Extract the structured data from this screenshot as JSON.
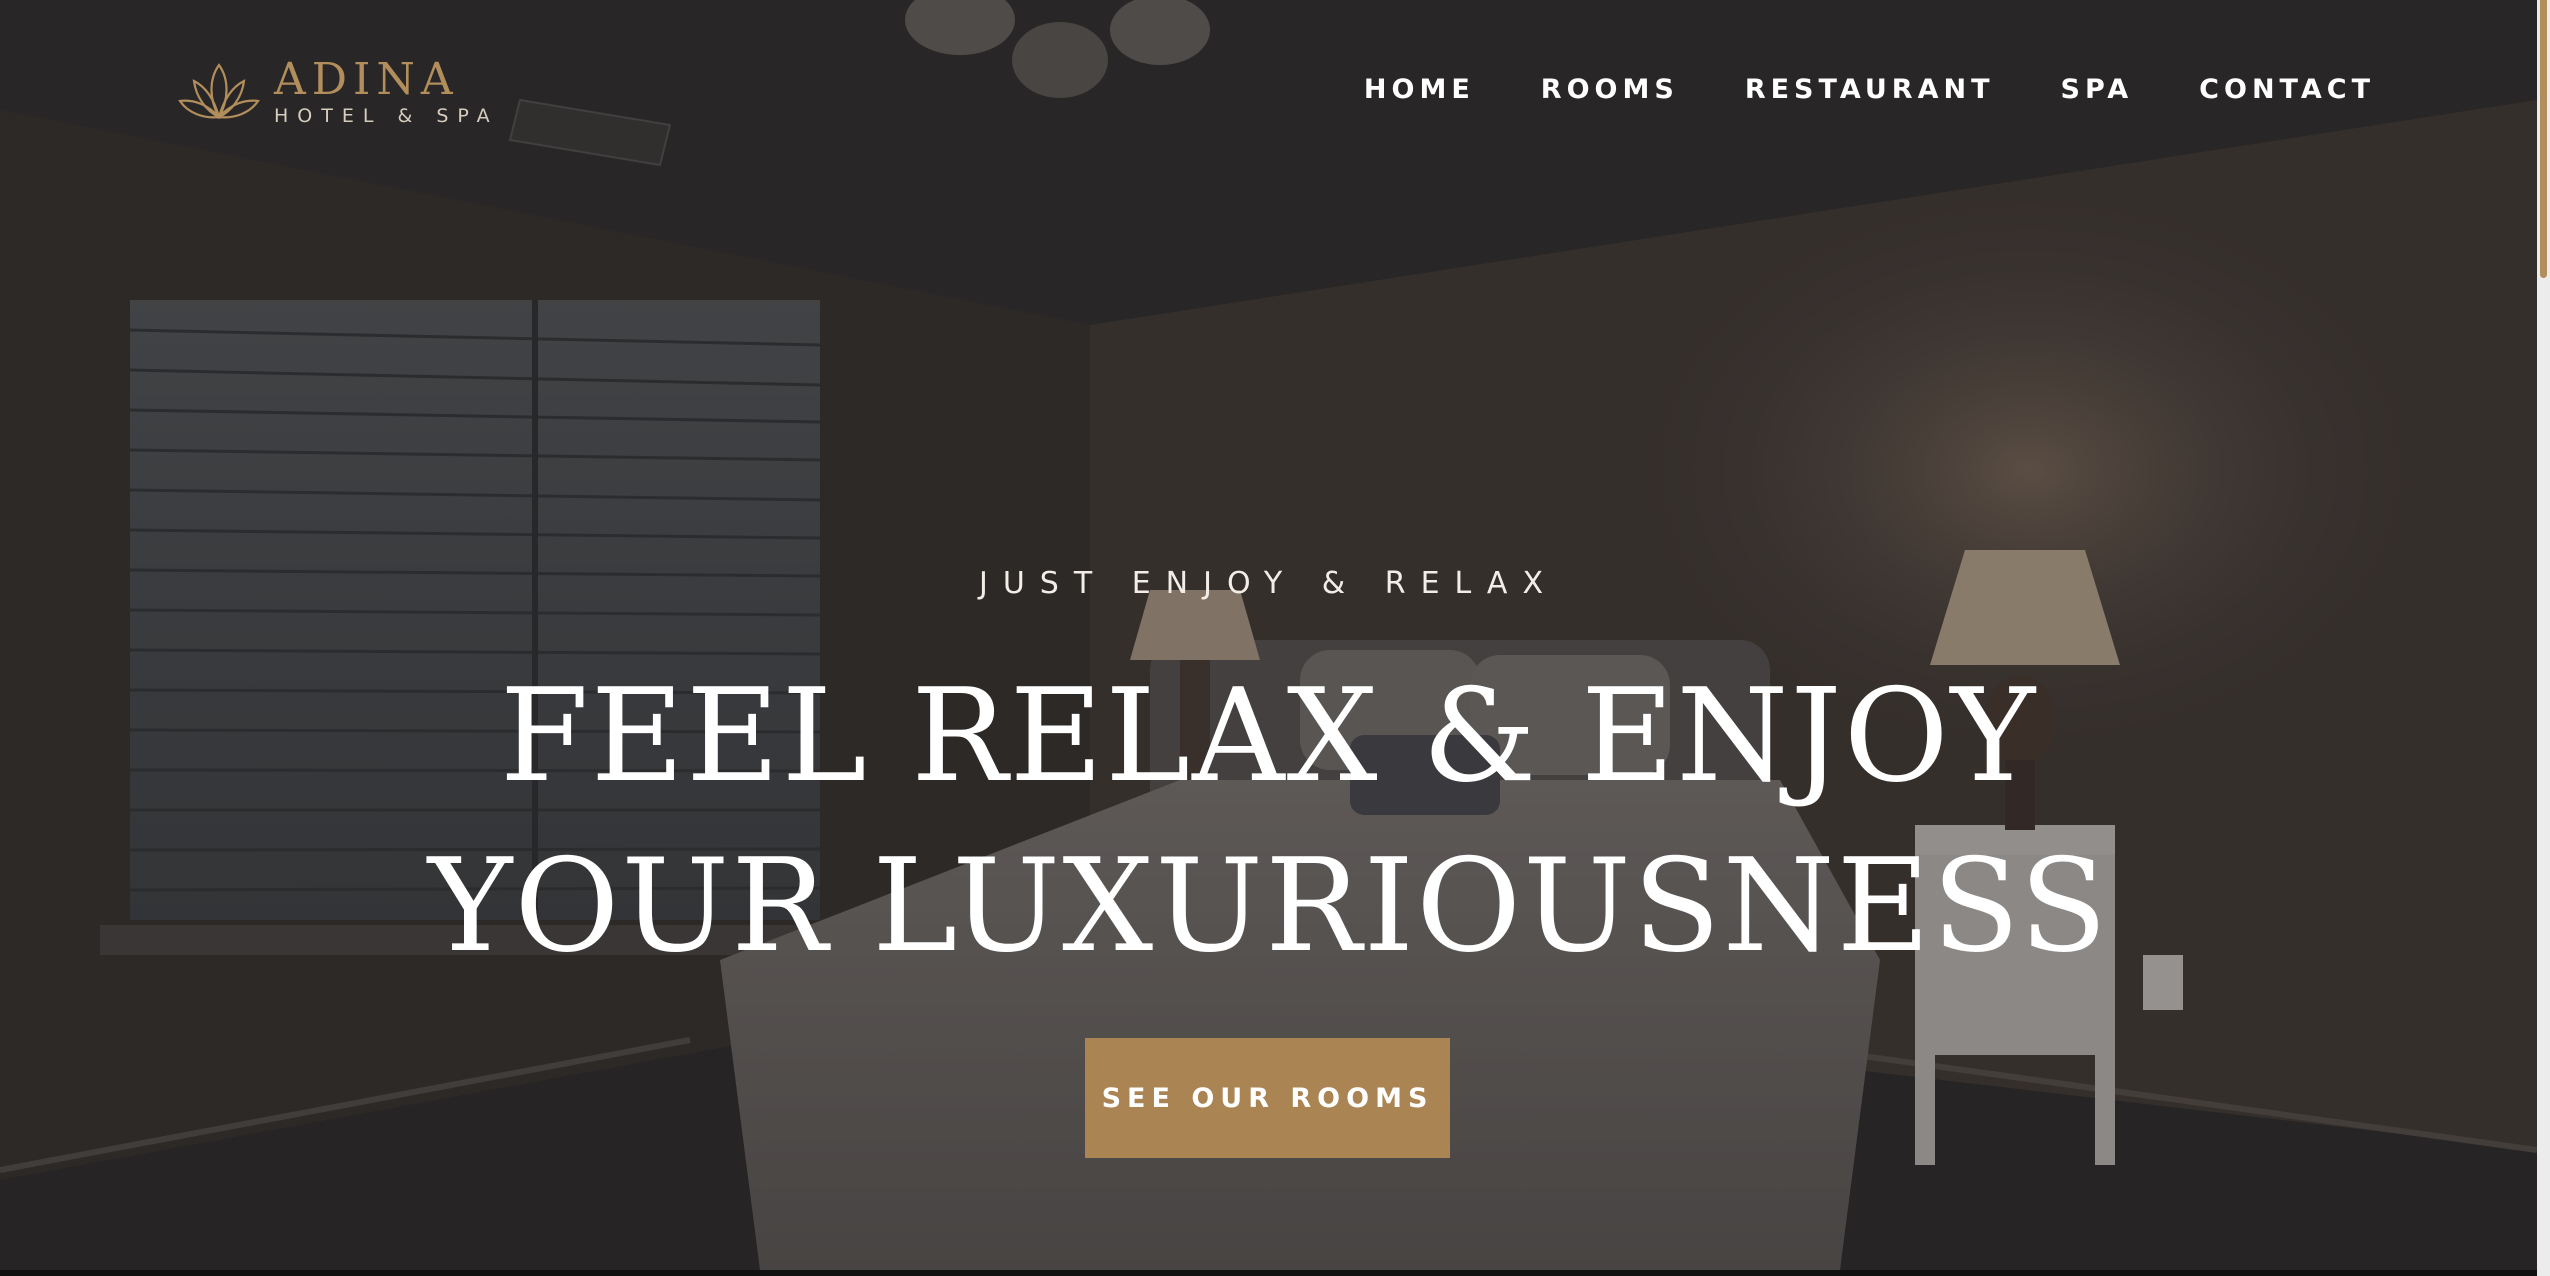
{
  "brand": {
    "name": "ADINA",
    "tagline": "HOTEL & SPA",
    "accent_color": "#aa8453"
  },
  "nav": {
    "items": [
      {
        "label": "HOME"
      },
      {
        "label": "ROOMS"
      },
      {
        "label": "RESTAURANT"
      },
      {
        "label": "SPA"
      },
      {
        "label": "CONTACT"
      }
    ]
  },
  "hero": {
    "kicker": "JUST ENJOY & RELAX",
    "headline_line1": "FEEL RELAX & ENJOY",
    "headline_line2": "YOUR LUXURIOUSNESS",
    "cta_label": "SEE OUR ROOMS"
  }
}
